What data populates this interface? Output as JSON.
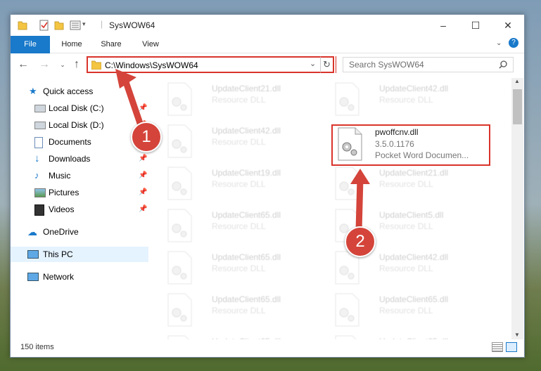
{
  "window": {
    "title": "SysWOW64"
  },
  "ribbon": {
    "tabs": [
      "File",
      "Home",
      "Share",
      "View"
    ]
  },
  "address": {
    "path": "C:\\Windows\\SysWOW64"
  },
  "search": {
    "placeholder": "Search SysWOW64"
  },
  "sidebar": {
    "items": [
      {
        "label": "Quick access",
        "icon": "star-icon"
      },
      {
        "label": "Local Disk (C:)",
        "icon": "drive-icon"
      },
      {
        "label": "Local Disk (D:)",
        "icon": "drive-icon"
      },
      {
        "label": "Documents",
        "icon": "documents-icon"
      },
      {
        "label": "Downloads",
        "icon": "download-arrow-icon"
      },
      {
        "label": "Music",
        "icon": "music-icon"
      },
      {
        "label": "Pictures",
        "icon": "pictures-icon"
      },
      {
        "label": "Videos",
        "icon": "videos-icon"
      },
      {
        "label": "OneDrive",
        "icon": "cloud-icon"
      },
      {
        "label": "This PC",
        "icon": "computer-icon"
      },
      {
        "label": "Network",
        "icon": "network-icon"
      }
    ]
  },
  "files": {
    "left": [
      {
        "name": "UpdateClient21.dll",
        "type": "Resource DLL"
      },
      {
        "name": "UpdateClient42.dll",
        "type": "Resource DLL"
      },
      {
        "name": "UpdateClient19.dll",
        "type": "Resource DLL"
      },
      {
        "name": "UpdateClient65.dll",
        "type": "Resource DLL"
      },
      {
        "name": "UpdateClient65.dll",
        "type": "Resource DLL"
      },
      {
        "name": "UpdateClient65.dll",
        "type": "Resource DLL"
      },
      {
        "name": "UpdateClient65.dll",
        "type": "Resource DLL"
      }
    ],
    "right": [
      {
        "name": "UpdateClient42.dll",
        "type": "Resource DLL"
      },
      {
        "name": "UpdateClient21.dll",
        "type": "Resource DLL"
      },
      {
        "name": "UpdateClient5.dll",
        "type": "Resource DLL"
      },
      {
        "name": "UpdateClient42.dll",
        "type": "Resource DLL"
      },
      {
        "name": "UpdateClient65.dll",
        "type": "Resource DLL"
      },
      {
        "name": "UpdateClient65.dll",
        "type": "Resource DLL"
      }
    ],
    "highlighted": {
      "name": "pwoffcnv.dll",
      "version": "3.5.0.1176",
      "description": "Pocket Word Documen..."
    }
  },
  "status": {
    "items": "150 items"
  },
  "annotations": {
    "one": "1",
    "two": "2"
  },
  "colors": {
    "accent": "#1979ca",
    "highlight": "#d9342b"
  }
}
